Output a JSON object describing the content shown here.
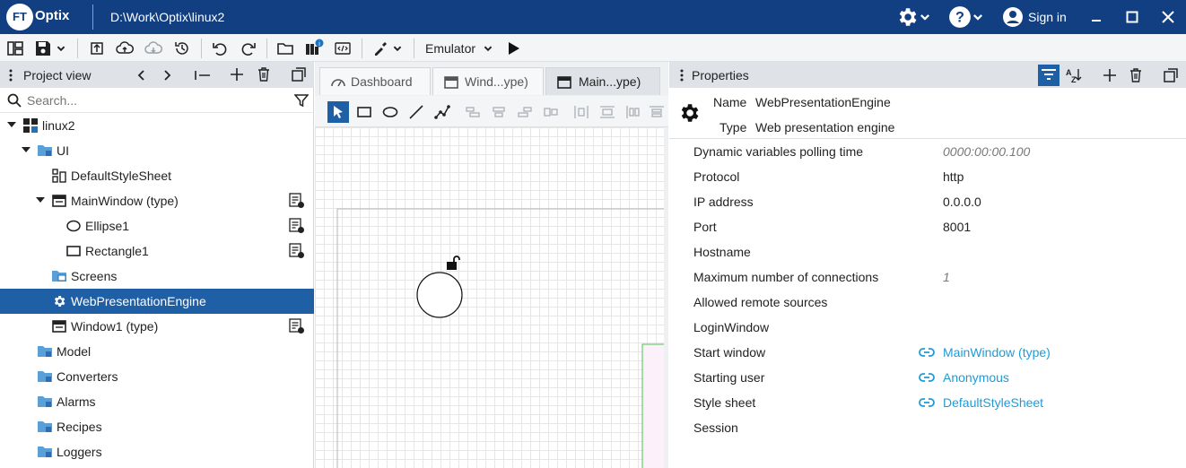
{
  "app": {
    "logo_ft": "FT",
    "logo_name": "Optix",
    "path": "D:\\Work\\Optix\\linux2",
    "sign_in": "Sign in"
  },
  "toolbar": {
    "emulator_label": "Emulator"
  },
  "project_view": {
    "title": "Project view",
    "search_placeholder": "Search...",
    "tree": [
      {
        "label": "linux2",
        "icon": "project-icon"
      },
      {
        "label": "UI",
        "icon": "folder-icon"
      },
      {
        "label": "DefaultStyleSheet",
        "icon": "stylesheet-icon"
      },
      {
        "label": "MainWindow (type)",
        "icon": "window-icon"
      },
      {
        "label": "Ellipse1",
        "icon": "ellipse-icon"
      },
      {
        "label": "Rectangle1",
        "icon": "rectangle-icon"
      },
      {
        "label": "Screens",
        "icon": "screens-folder-icon"
      },
      {
        "label": "WebPresentationEngine",
        "icon": "gear-icon"
      },
      {
        "label": "Window1 (type)",
        "icon": "window-icon"
      },
      {
        "label": "Model",
        "icon": "folder-icon"
      },
      {
        "label": "Converters",
        "icon": "folder-icon"
      },
      {
        "label": "Alarms",
        "icon": "folder-icon"
      },
      {
        "label": "Recipes",
        "icon": "folder-icon"
      },
      {
        "label": "Loggers",
        "icon": "folder-icon"
      }
    ]
  },
  "editor": {
    "tabs": [
      {
        "label": "Dashboard"
      },
      {
        "label": "Wind...ype)"
      },
      {
        "label": "Main...ype)"
      }
    ]
  },
  "properties": {
    "title": "Properties",
    "name_label": "Name",
    "name_value": "WebPresentationEngine",
    "type_label": "Type",
    "type_value": "Web presentation engine",
    "rows": [
      {
        "key": "Dynamic variables polling time",
        "value": "0000:00:00.100"
      },
      {
        "key": "Protocol",
        "value": "http"
      },
      {
        "key": "IP address",
        "value": "0.0.0.0"
      },
      {
        "key": "Port",
        "value": "8001"
      },
      {
        "key": "Hostname",
        "value": ""
      },
      {
        "key": "Maximum number of connections",
        "value": "1"
      },
      {
        "key": "Allowed remote sources",
        "value": ""
      },
      {
        "key": "LoginWindow",
        "value": ""
      },
      {
        "key": "Start window",
        "value": "MainWindow (type)"
      },
      {
        "key": "Starting user",
        "value": "Anonymous"
      },
      {
        "key": "Style sheet",
        "value": "DefaultStyleSheet"
      },
      {
        "key": "Session",
        "value": ""
      }
    ]
  },
  "colors": {
    "titlebar": "#123f82",
    "selection": "#1f5fa5",
    "link": "#1e9bd7",
    "panel_header": "#dfe3e8"
  }
}
